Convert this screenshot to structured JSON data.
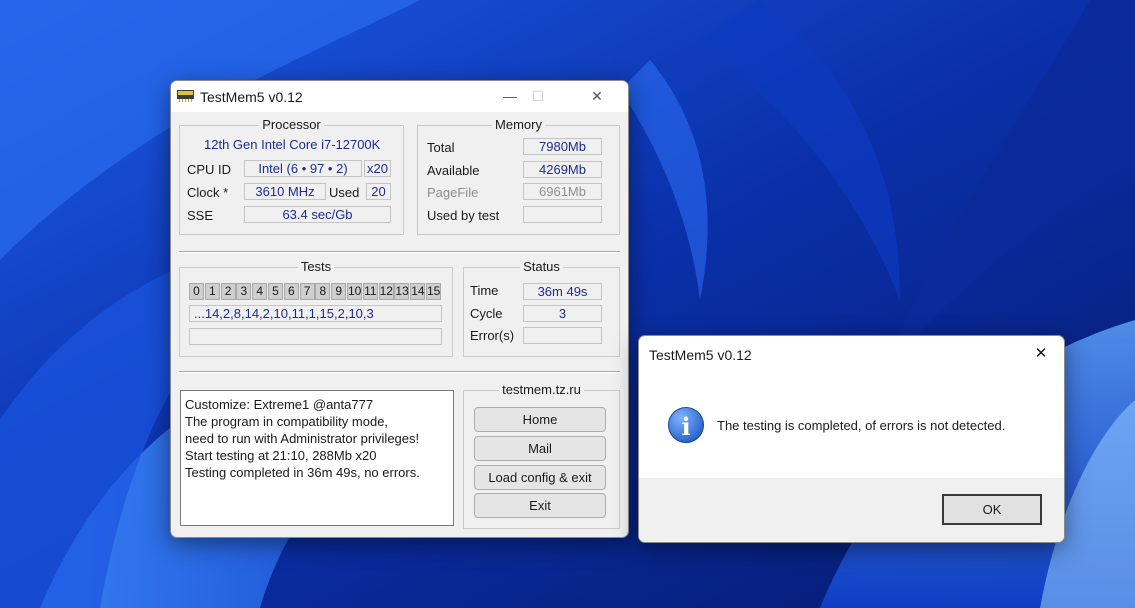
{
  "main_window": {
    "title": "TestMem5 v0.12",
    "minimize_glyph": "—",
    "maximize_glyph": "☐",
    "close_glyph": "✕"
  },
  "processor": {
    "group_label": "Processor",
    "name": "12th Gen Intel Core i7-12700K",
    "cpu_id_label": "CPU ID",
    "cpu_id_value": "Intel (6 • 97 • 2)",
    "threads": "x20",
    "clock_label": "Clock *",
    "clock_value": "3610 MHz",
    "used_label": "Used",
    "used_value": "20",
    "sse_label": "SSE",
    "sse_value": "63.4 sec/Gb"
  },
  "memory": {
    "group_label": "Memory",
    "total_label": "Total",
    "total_value": "7980Mb",
    "available_label": "Available",
    "available_value": "4269Mb",
    "pagefile_label": "PageFile",
    "pagefile_value": "6961Mb",
    "used_by_test_label": "Used by test",
    "used_by_test_value": ""
  },
  "tests": {
    "group_label": "Tests",
    "cells": [
      "0",
      "1",
      "2",
      "3",
      "4",
      "5",
      "6",
      "7",
      "8",
      "9",
      "10",
      "11",
      "12",
      "13",
      "14",
      "15"
    ],
    "sequence": "...14,2,8,14,2,10,11,1,15,2,10,3",
    "progress": ""
  },
  "status": {
    "group_label": "Status",
    "time_label": "Time",
    "time_value": "36m 49s",
    "cycle_label": "Cycle",
    "cycle_value": "3",
    "errors_label": "Error(s)",
    "errors_value": ""
  },
  "log": {
    "lines": [
      "Customize: Extreme1 @anta777",
      "The program in compatibility mode,",
      "need to run with Administrator privileges!",
      "Start testing at 21:10, 288Mb x20",
      "Testing completed in 36m 49s, no errors."
    ]
  },
  "links": {
    "group_label": "testmem.tz.ru",
    "home": "Home",
    "mail": "Mail",
    "load_config_exit": "Load config & exit",
    "exit": "Exit"
  },
  "dialog": {
    "title": "TestMem5 v0.12",
    "close_glyph": "✕",
    "icon_glyph": "i",
    "message": "The testing is completed, of errors is not detected.",
    "ok": "OK"
  },
  "icons": {
    "app": "memory-chip-icon",
    "dialog": "info-icon"
  },
  "colors": {
    "value_text": "#1e2b8f",
    "window_bg": "#f0f0f0",
    "info_icon": "#1f5bc2"
  }
}
